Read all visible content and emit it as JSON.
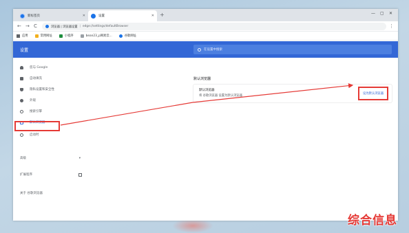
{
  "colors": {
    "accent": "#3367d6",
    "annotation": "#e53935",
    "tabstrip": "#dfe3e8",
    "stamp": "#e53935"
  },
  "browser": {
    "tabs": [
      {
        "title": "新标签页",
        "icon": "chrome-favicon",
        "active": false
      },
      {
        "title": "设置",
        "icon": "settings-favicon",
        "active": true
      }
    ],
    "new_tab": "+",
    "window_controls": {
      "minimize": "—",
      "maximize": "▢",
      "close": "✕"
    },
    "nav": {
      "back": "←",
      "forward": "→",
      "reload": "C"
    },
    "omnibox": {
      "label": "浏览器 | 浏览器设置",
      "separator": "|",
      "url": "edge://settings/defaultBrowser"
    },
    "menu": "⋮"
  },
  "bookmarks": [
    {
      "label": "应用",
      "icon": "apps-icon"
    },
    {
      "label": "常用网址",
      "icon": "folder-icon"
    },
    {
      "label": "小程序",
      "icon": "sheet-icon"
    },
    {
      "label": "bean23_p网易云...",
      "icon": "page-icon"
    },
    {
      "label": "谷歌网址",
      "icon": "globe-icon"
    }
  ],
  "settings": {
    "title": "设置",
    "search_placeholder": "在设置中搜索",
    "sidebar": [
      {
        "label": "您与 Google",
        "icon": "person-icon"
      },
      {
        "label": "自动填充",
        "icon": "clipboard-icon"
      },
      {
        "label": "隐私设置和安全性",
        "icon": "shield-icon"
      },
      {
        "label": "外观",
        "icon": "palette-icon"
      },
      {
        "label": "搜索引擎",
        "icon": "search-icon"
      },
      {
        "label": "默认浏览器",
        "icon": "browser-icon",
        "selected": true
      },
      {
        "label": "启动时",
        "icon": "power-icon"
      }
    ],
    "advanced": {
      "label": "高级",
      "chevron": "▾"
    },
    "extensions": {
      "label": "扩展程序",
      "icon": "external-link-icon"
    },
    "about": {
      "label": "关于 谷歌浏览器"
    },
    "main": {
      "section_title": "默认浏览器",
      "card_title": "默认浏览器",
      "card_subtitle": "将 谷歌浏览器 设置为默认浏览器",
      "make_default_button": "设为默认浏览器"
    }
  },
  "watermark": "← ■",
  "stamp": "综合信息"
}
